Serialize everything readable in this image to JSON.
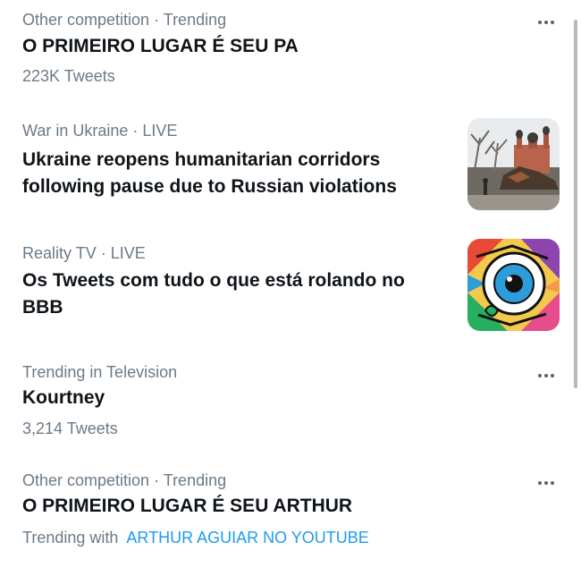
{
  "trends": [
    {
      "meta": "Other competition · Trending",
      "title": "O PRIMEIRO LUGAR É SEU PA",
      "count": "223K Tweets",
      "more_icon": "more-horizontal-icon"
    },
    {
      "meta": "War in Ukraine · LIVE",
      "title_line1": "Ukraine reopens humanitarian corridors",
      "title_line2": "following pause due to Russian violations",
      "thumbnail": "church-ruins-photo"
    },
    {
      "meta": "Reality TV · LIVE",
      "title_line1": "Os Tweets com tudo o que está rolando no",
      "title_line2": "BBB",
      "thumbnail": "colorful-eye-logo"
    },
    {
      "meta": "Trending in Television",
      "title": "Kourtney",
      "count": "3,214 Tweets",
      "more_icon": "more-horizontal-icon"
    },
    {
      "meta": "Other competition · Trending",
      "title": "O PRIMEIRO LUGAR É SEU ARTHUR",
      "trending_with_label": "Trending with",
      "trending_with_link": "ARTHUR AGUIAR NO YOUTUBE",
      "more_icon": "more-horizontal-icon"
    }
  ],
  "colors": {
    "text": "#0f1419",
    "secondary": "#6b7a88",
    "link": "#1d9bf0"
  }
}
